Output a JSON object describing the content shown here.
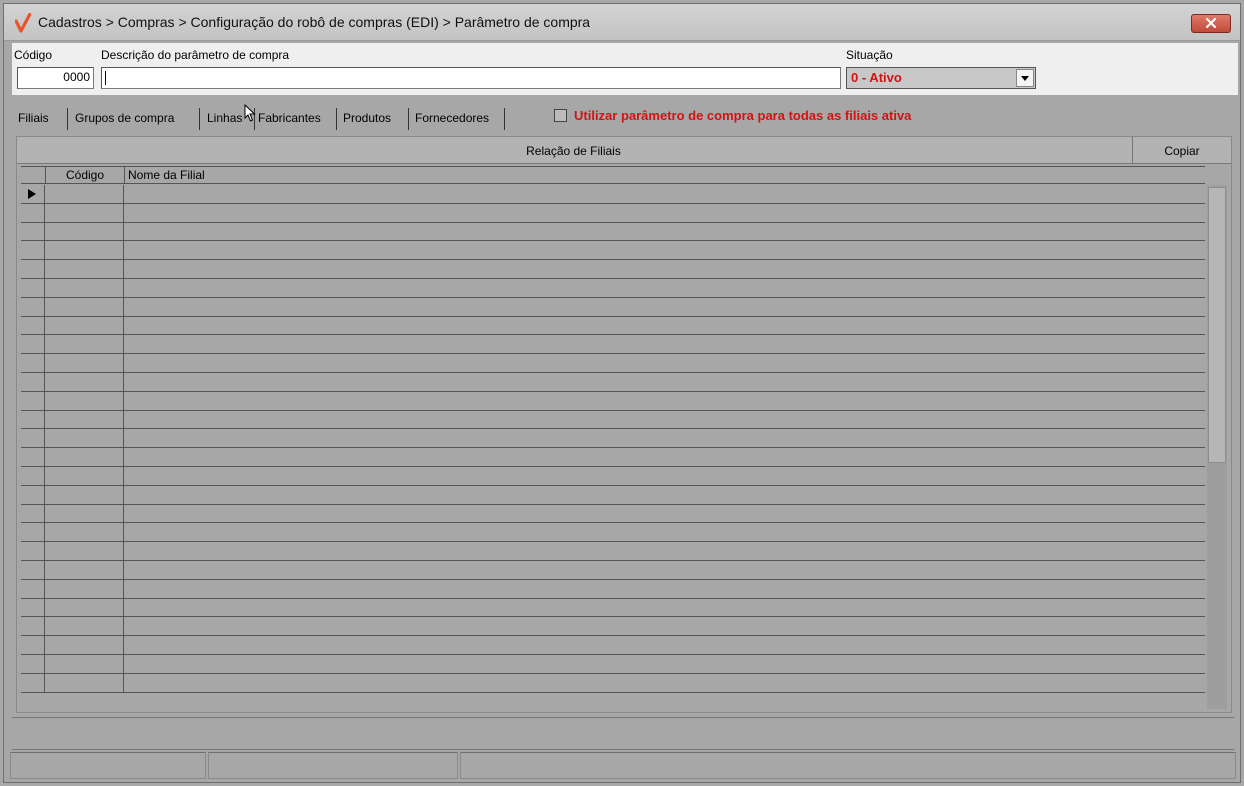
{
  "window": {
    "title": "Cadastros > Compras > Configuração do robô de compras (EDI) > Parâmetro de compra",
    "accent_color": "#e8542c",
    "close_icon": "close-icon"
  },
  "form": {
    "codigo_label": "Código",
    "codigo_value": "0000",
    "descricao_label": "Descrição do parâmetro de compra",
    "descricao_value": "",
    "situacao_label": "Situação",
    "situacao_value": "0 - Ativo",
    "situacao_color": "#d41212"
  },
  "tabs": [
    {
      "label": "Filiais",
      "active": true
    },
    {
      "label": "Grupos de compra"
    },
    {
      "label": "Linhas"
    },
    {
      "label": "Fabricantes"
    },
    {
      "label": "Produtos"
    },
    {
      "label": "Fornecedores"
    }
  ],
  "todas_filiais": {
    "label": "Utilizar parâmetro de compra para todas as filiais ativa",
    "checked": false
  },
  "grid": {
    "title": "Relação de Filiais",
    "copy_button": "Copiar",
    "columns": [
      "Código",
      "Nome da Filial"
    ],
    "rows": []
  },
  "statusbar": {
    "cells": [
      "",
      "",
      ""
    ]
  }
}
